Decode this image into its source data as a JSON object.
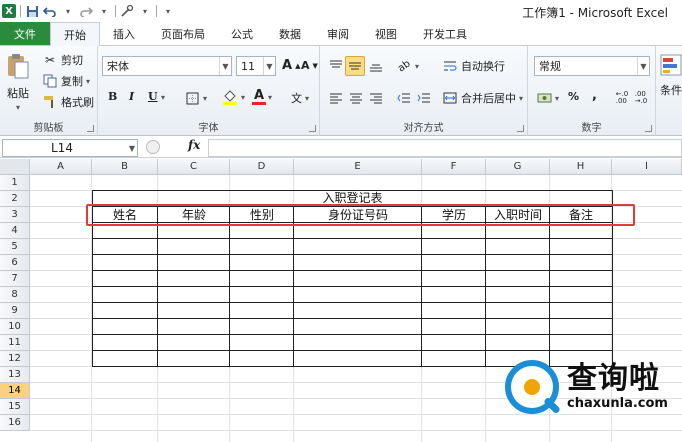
{
  "window": {
    "title": "工作簿1 - Microsoft Excel"
  },
  "qat": {
    "logo": "X"
  },
  "tabs": [
    {
      "label": "文件"
    },
    {
      "label": "开始"
    },
    {
      "label": "插入"
    },
    {
      "label": "页面布局"
    },
    {
      "label": "公式"
    },
    {
      "label": "数据"
    },
    {
      "label": "审阅"
    },
    {
      "label": "视图"
    },
    {
      "label": "开发工具"
    }
  ],
  "clipboard": {
    "paste": "粘贴",
    "cut": "剪切",
    "copy": "复制",
    "format_painter": "格式刷",
    "label": "剪贴板"
  },
  "font": {
    "name": "宋体",
    "size": "11",
    "grow": "A",
    "shrink": "A",
    "bold": "B",
    "italic": "I",
    "underline": "U",
    "color_letter": "A",
    "phonetic": "文",
    "label": "字体"
  },
  "alignment": {
    "wrap": "自动换行",
    "merge": "合并后居中",
    "label": "对齐方式"
  },
  "number": {
    "format": "常规",
    "percent": "%",
    "comma": ",",
    "label": "数字"
  },
  "styles": {
    "conditional": "条件"
  },
  "formula_bar": {
    "name_box": "L14",
    "fx": "fx",
    "value": ""
  },
  "grid": {
    "columns": [
      "A",
      "B",
      "C",
      "D",
      "E",
      "F",
      "G",
      "H",
      "I"
    ],
    "rows": [
      "1",
      "2",
      "3",
      "4",
      "5",
      "6",
      "7",
      "8",
      "9",
      "10",
      "11",
      "12",
      "13",
      "14",
      "15",
      "16"
    ],
    "selected_row": "14",
    "table_title": "入职登记表",
    "headers": [
      "姓名",
      "年龄",
      "性别",
      "身份证号码",
      "学历",
      "入职时间",
      "备注"
    ]
  },
  "watermark": {
    "cn": "查询啦",
    "en": "chaxunla.com"
  },
  "colors": {
    "file_tab": "#2a8a3d",
    "highlight": "#e03a3a",
    "selected_row": "#f9d27c"
  }
}
